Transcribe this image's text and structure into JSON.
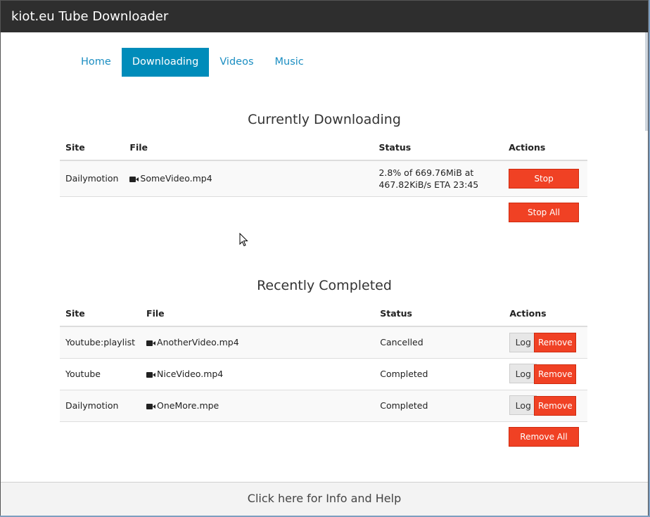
{
  "window": {
    "title": "kiot.eu Tube Downloader"
  },
  "nav": {
    "tabs": [
      {
        "label": "Home"
      },
      {
        "label": "Downloading"
      },
      {
        "label": "Videos"
      },
      {
        "label": "Music"
      }
    ],
    "active_tab": "Downloading"
  },
  "currently_downloading": {
    "title": "Currently Downloading",
    "columns": {
      "site": "Site",
      "file": "File",
      "status": "Status",
      "actions": "Actions"
    },
    "rows": [
      {
        "site": "Dailymotion",
        "file": "SomeVideo.mp4",
        "status_line1": "2.8% of 669.76MiB at",
        "status_line2": "467.82KiB/s ETA 23:45",
        "stop_label": "Stop"
      }
    ],
    "stop_all_label": "Stop All"
  },
  "recently_completed": {
    "title": "Recently Completed",
    "columns": {
      "site": "Site",
      "file": "File",
      "status": "Status",
      "actions": "Actions"
    },
    "rows": [
      {
        "site": "Youtube:playlist",
        "file": "AnotherVideo.mp4",
        "status": "Cancelled",
        "log_label": "Log",
        "remove_label": "Remove"
      },
      {
        "site": "Youtube",
        "file": "NiceVideo.mp4",
        "status": "Completed",
        "log_label": "Log",
        "remove_label": "Remove"
      },
      {
        "site": "Dailymotion",
        "file": "OneMore.mpe",
        "status": "Completed",
        "log_label": "Log",
        "remove_label": "Remove"
      }
    ],
    "remove_all_label": "Remove All"
  },
  "footer": {
    "label": "Click here for Info and Help"
  },
  "icons": {
    "file": "video-camera-icon",
    "cursor": "mouse-pointer-icon"
  },
  "colors": {
    "accent": "#008cba",
    "danger": "#f04124",
    "titlebar": "#2e2e2e"
  }
}
